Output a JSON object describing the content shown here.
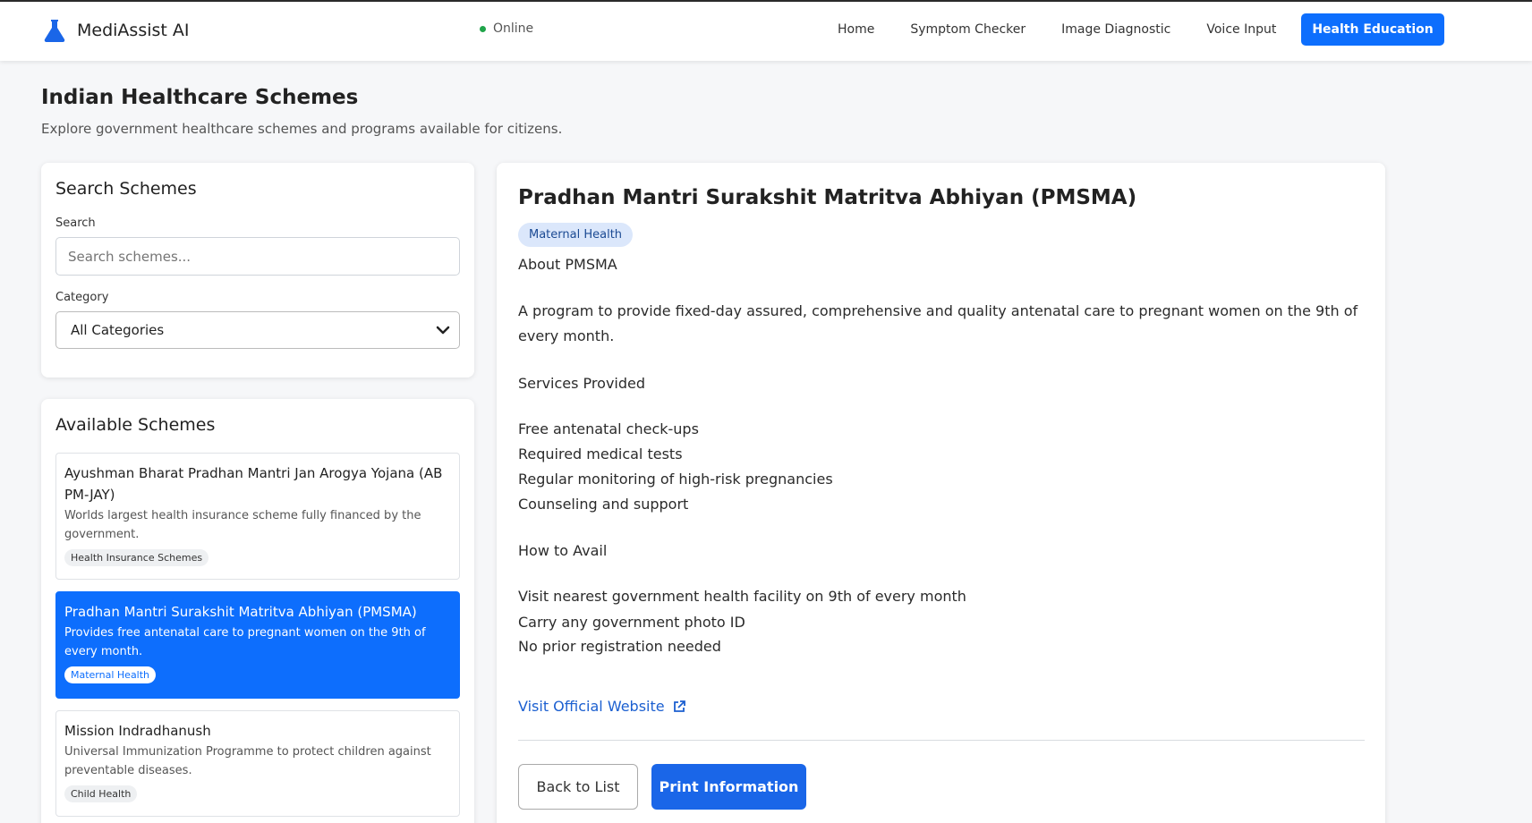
{
  "navbar": {
    "brand": "MediAssist AI",
    "status": "Online",
    "links": [
      "Home",
      "Symptom Checker",
      "Image Diagnostic",
      "Voice Input"
    ],
    "active_link": "Health Education",
    "colors": {
      "accent": "#0d6efd",
      "status_dot": "#20a44a"
    }
  },
  "header": {
    "title": "Indian Healthcare Schemes",
    "subtitle": "Explore government healthcare schemes and programs available for citizens."
  },
  "search": {
    "title": "Search Schemes",
    "search_label": "Search",
    "search_placeholder": "Search schemes...",
    "category_label": "Category",
    "category_value": "All Categories"
  },
  "schemes": {
    "title": "Available Schemes",
    "items": [
      {
        "name": "Ayushman Bharat Pradhan Mantri Jan Arogya Yojana (AB PM-JAY)",
        "desc": "Worlds largest health insurance scheme fully financed by the government.",
        "tag": "Health Insurance Schemes",
        "selected": false
      },
      {
        "name": "Pradhan Mantri Surakshit Matritva Abhiyan (PMSMA)",
        "desc": "Provides free antenatal care to pregnant women on the 9th of every month.",
        "tag": "Maternal Health",
        "selected": true
      },
      {
        "name": "Mission Indradhanush",
        "desc": "Universal Immunization Programme to protect children against preventable diseases.",
        "tag": "Child Health",
        "selected": false
      }
    ]
  },
  "detail": {
    "title": "Pradhan Mantri Surakshit Matritva Abhiyan (PMSMA)",
    "badge": "Maternal Health",
    "about_heading": "About PMSMA",
    "about_text": "A program to provide fixed-day assured, comprehensive and quality antenatal care to pregnant women on the 9th of every month.",
    "services_heading": "Services Provided",
    "services": [
      "Free antenatal check-ups",
      "Required medical tests",
      "Regular monitoring of high-risk pregnancies",
      "Counseling and support"
    ],
    "avail_heading": "How to Avail",
    "avail_steps": [
      "Visit nearest government health facility on 9th of every month",
      "Carry any government photo ID",
      "No prior registration needed"
    ],
    "website_link": "Visit Official Website",
    "back_button": "Back to List",
    "print_button": "Print Information"
  }
}
